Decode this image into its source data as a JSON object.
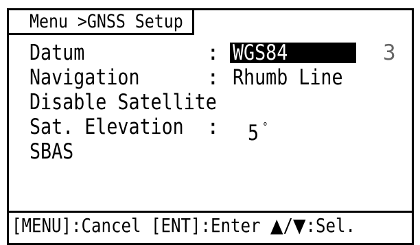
{
  "title": "Menu >GNSS Setup",
  "items": [
    {
      "label": "Datum",
      "colon": ":",
      "value": "WGS84",
      "hint": "3"
    },
    {
      "label": "Navigation",
      "colon": ":",
      "value": "Rhumb Line"
    },
    {
      "label": "Disable Satellite"
    },
    {
      "label": "Sat. Elevation",
      "colon": ":",
      "value": "5",
      "unit": "°"
    },
    {
      "label": "SBAS"
    }
  ],
  "status": {
    "cancel": "[MENU]:Cancel",
    "enter": "[ENT]:Enter",
    "up_arrow": "▲",
    "slash": "/",
    "down_arrow": "▼",
    "select": ":Sel."
  },
  "colors": {
    "text": "#000000",
    "background": "#ffffff",
    "highlight": "#000000",
    "hint": "#666666"
  }
}
